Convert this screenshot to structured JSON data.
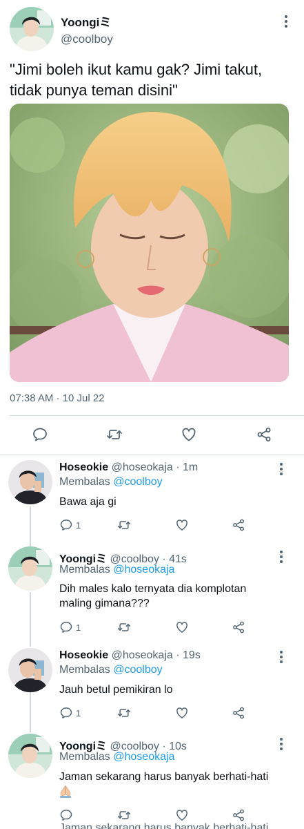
{
  "main_tweet": {
    "author_name": "Yoongi",
    "author_suffix": "ミ",
    "handle": "@coolboy",
    "text": "\"Jimi boleh ikut kamu gak? Jimi takut, tidak punya teman disini\"",
    "timestamp": "07:38 AM · 10 Jul 22",
    "icons": [
      "reply-icon",
      "retweet-icon",
      "like-icon",
      "share-icon"
    ]
  },
  "replies": [
    {
      "name": "Hoseokie",
      "name_suffix": "",
      "handle": "@hoseokaja",
      "time": "1m",
      "replying_label": "Membalas",
      "replying_to": "@coolboy",
      "text": "Bawa aja gi",
      "reply_count": "1"
    },
    {
      "name": "Yoongi",
      "name_suffix": "ミ",
      "handle": "@coolboy",
      "time": "41s",
      "replying_label": "Membalas",
      "replying_to": "@hoseokaja",
      "text": "Dih males kalo ternyata dia komplotan maling gimana???",
      "reply_count": "1"
    },
    {
      "name": "Hoseokie",
      "name_suffix": "",
      "handle": "@hoseokaja",
      "time": "19s",
      "replying_label": "Membalas",
      "replying_to": "@coolboy",
      "text": "Jauh betul pemikiran lo",
      "reply_count": "1"
    },
    {
      "name": "Yoongi",
      "name_suffix": "ミ",
      "handle": "@coolboy",
      "time": "10s",
      "replying_label": "Membalas",
      "replying_to": "@hoseokaja",
      "text": "Jaman sekarang harus banyak berhati-hati",
      "reply_count": ""
    }
  ],
  "cut_off_text": "Jaman sekarang harus banyak berhati-hati",
  "colors": {
    "text": "#0f1419",
    "secondary": "#536471",
    "link": "#1d9bf0",
    "divider": "#cfd9de"
  }
}
